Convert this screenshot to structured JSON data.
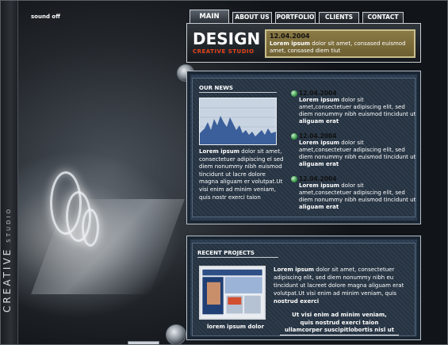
{
  "sound": {
    "label": "sound off"
  },
  "brand": {
    "vertical_main": "CREATIVE",
    "vertical_sub": "STUDIO"
  },
  "nav": {
    "tabs": [
      {
        "label": "MAIN"
      },
      {
        "label": "ABOUT US"
      },
      {
        "label": "PORTFOLIO"
      },
      {
        "label": "CLIENTS"
      },
      {
        "label": "CONTACT US"
      }
    ]
  },
  "header": {
    "title": "DESIGN",
    "subtitle": "CREATIVE STUDIO",
    "ticker_date": "12.04.2004",
    "ticker_lead": "Lorem ipsum",
    "ticker_text": "dolor sit amet, consased euismod    amet, consased diem  tiut"
  },
  "news": {
    "heading": "OUR NEWS",
    "left_lead": "Lorem ipsum",
    "left_text": "dolor sit amet, consectetuer adipiscing el sed diem nonummy nibh euismod tincidunt ut lacre dolore magna aliguam er volutpat.Ut visi enim ad minim veniam, quis nostr exerci taion",
    "items": [
      {
        "date": "12.04.2004",
        "lead": "Lorem ipsum",
        "text": "dolor sit amet,consectetuer adipiscing elit, sed diem nonummy nibh euismod tincidunt ut lacreet dolore magna",
        "tail": "aliguam erat"
      },
      {
        "date": "12.04.2004",
        "lead": "Lorem ipsum",
        "text": "dolor sit amet,consectetuer adipiscing elit, sed diem nonummy nibh euismod tincidunt ut lacreet dolore magna",
        "tail": "aliguam erat"
      },
      {
        "date": "12.04.2004",
        "lead": "Lorem ipsum",
        "text": "dolor sit amet,consectetuer adipiscing elit, sed diem nonummy nibh euismod tincidunt ut lacreet dolore magna",
        "tail": "aliguam erat"
      }
    ]
  },
  "projects": {
    "heading": "RECENT PROJECTS",
    "caption": "lorem ipsum dolor",
    "lead": "Lorem ipsum",
    "text": "dolor sit amet, consectetuer adipiscing elit, sed diem nonummy nibh eu tincidunt ut lacreet dolore magna aliguam erat volutpat.Ut visi enim ad minim veniam, quis",
    "tail": "nostrud exerci",
    "quote_1": "Ut visi enim ad minim veniam,",
    "quote_2": "quis nostrud exerci taion",
    "quote_3": "ullamcorper suscipitlobortis nisl ut"
  },
  "colors": {
    "accent_orange": "#e8431c",
    "ticker_gold": "#8a7a45",
    "panel_blue": "#2f4156"
  }
}
